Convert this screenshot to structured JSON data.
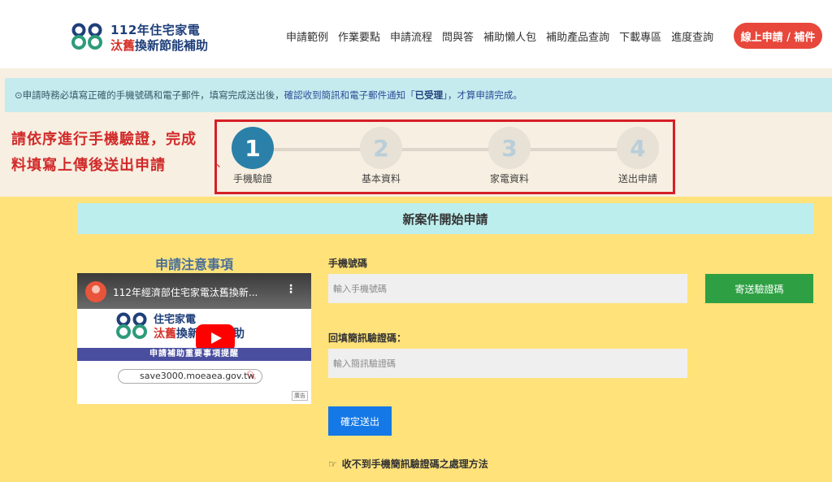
{
  "brand": {
    "line1": "112年住宅家電",
    "line2_red": "汰舊",
    "line2_blue": "換新節能補助",
    "colors": {
      "blue": "#1f3f7a",
      "green": "#2e9b7a",
      "red": "#d6322b"
    }
  },
  "nav": {
    "items": [
      "申請範例",
      "作業要點",
      "申請流程",
      "問與答",
      "補助懶人包",
      "補助產品查詢",
      "下載專區",
      "進度查詢"
    ],
    "apply_button": "線上申請 / 補件"
  },
  "notice": {
    "prefix": "⊙申請時務必填寫正確的手機號碼和電子郵件，填寫完成送出後，",
    "highlight": "確認收到簡訊和電子郵件通知「",
    "bold": "已受理",
    "suffix": "」，才算申請完成。"
  },
  "instruction": {
    "text": "請依序進行手機驗證，完成料填寫上傳後送出申請",
    "tick": "、"
  },
  "steps": [
    {
      "number": "1",
      "label": "手機驗證",
      "active": true
    },
    {
      "number": "2",
      "label": "基本資料",
      "active": false
    },
    {
      "number": "3",
      "label": "家電資料",
      "active": false
    },
    {
      "number": "4",
      "label": "送出申請",
      "active": false
    }
  ],
  "form": {
    "title": "新案件開始申請",
    "notes_title": "申請注意事項",
    "phone_label": "手機號碼",
    "phone_placeholder": "輸入手機號碼",
    "phone_value": "",
    "send_button": "寄送驗證碼",
    "code_label": "回填簡訊驗證碼：",
    "code_placeholder": "輸入簡訊驗證碼",
    "code_value": "",
    "submit_button": "確定送出",
    "help_link": "收不到手機簡訊驗證碼之處理方法",
    "help_icon": "pointing-hand-icon"
  },
  "video": {
    "title": "112年經濟部住宅家電汰舊換新...",
    "logo_line1": "住宅家電",
    "logo_line2_red": "汰舊",
    "logo_line2_blue": "換新節能補助",
    "banner": "申請補助重要事項提醒",
    "url": "save3000.moeaea.gov.tw",
    "badge": "廣告",
    "menu_icon": "more-vert-icon",
    "play_icon": "youtube-play-icon"
  }
}
